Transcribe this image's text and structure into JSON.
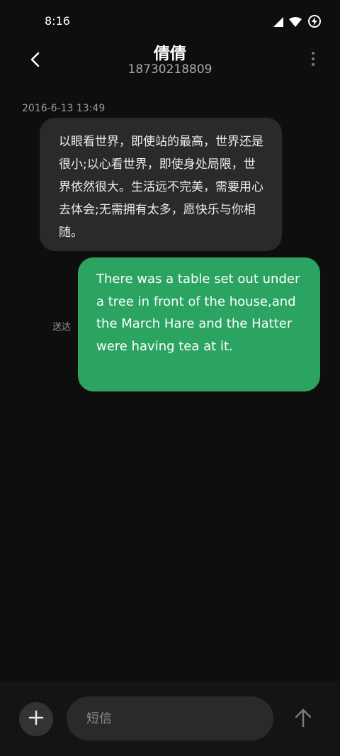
{
  "status_bar": {
    "time": "8:16",
    "icons": [
      "signal-icon",
      "wifi-icon",
      "battery-charging-icon"
    ]
  },
  "header": {
    "contact_name": "倩倩",
    "contact_number": "18730218809",
    "back_icon": "chevron-left-icon",
    "more_icon": "more-vertical-icon"
  },
  "conversation": {
    "timestamp": "2016-6-13 13:49",
    "messages": [
      {
        "direction": "received",
        "text": "以眼看世界，即使站的最高，世界还是很小;以心看世界，即使身处局限，世界依然很大。生活远不完美，需要用心去体会;无需拥有太多，愿快乐与你相随。"
      },
      {
        "direction": "sent",
        "status": "送达",
        "text": "There was a table set out under a tree in front of the house,and the March Hare and the Hatter were having tea at it."
      }
    ]
  },
  "composer": {
    "placeholder": "短信",
    "attach_icon": "plus-icon",
    "send_icon": "arrow-up-icon"
  },
  "colors": {
    "background": "#0e0e0e",
    "received_bubble": "#2a2a2a",
    "sent_bubble": "#2aa460",
    "secondary_text": "#a9a9a9"
  }
}
